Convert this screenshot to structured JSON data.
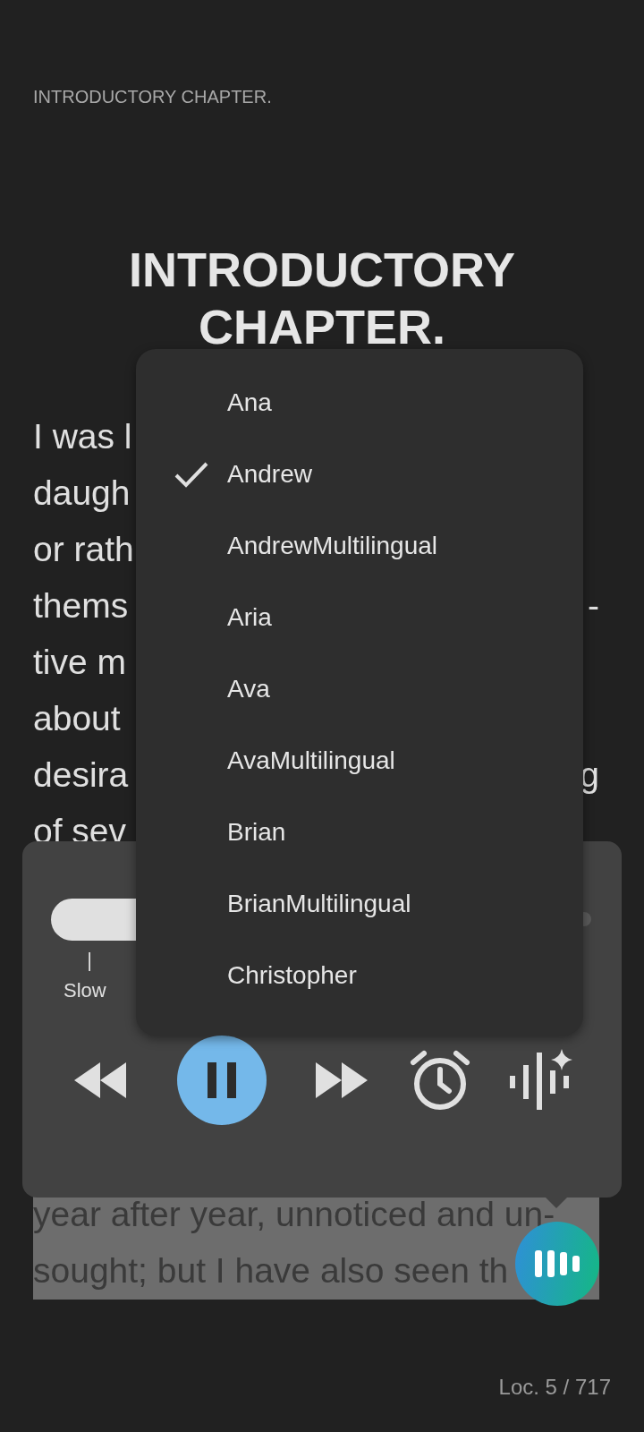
{
  "running_header": "INTRODUCTORY CHAPTER.",
  "chapter_title": "INTRODUCTORY CHAPTER.",
  "text_lines": [
    {
      "left": "I was l"
    },
    {
      "left": "daugh"
    },
    {
      "left": "or rath"
    },
    {
      "left": "thems",
      "right": "-"
    },
    {
      "left": "tive m"
    },
    {
      "left": "about"
    },
    {
      "left": "desira",
      "right": "g"
    },
    {
      "left": "of sev"
    }
  ],
  "highlighted_lines": [
    "year after year, unnoticed and un-",
    "sought; but I have also seen th"
  ],
  "location": "Loc. 5 / 717",
  "player": {
    "speed_label": "Slow",
    "tick": "|",
    "playing": true
  },
  "voice_menu": [
    {
      "label": "Ana",
      "selected": false
    },
    {
      "label": "Andrew",
      "selected": true
    },
    {
      "label": "AndrewMultilingual",
      "selected": false
    },
    {
      "label": "Aria",
      "selected": false
    },
    {
      "label": "Ava",
      "selected": false
    },
    {
      "label": "AvaMultilingual",
      "selected": false
    },
    {
      "label": "Brian",
      "selected": false
    },
    {
      "label": "BrianMultilingual",
      "selected": false
    },
    {
      "label": "Christopher",
      "selected": false
    }
  ]
}
